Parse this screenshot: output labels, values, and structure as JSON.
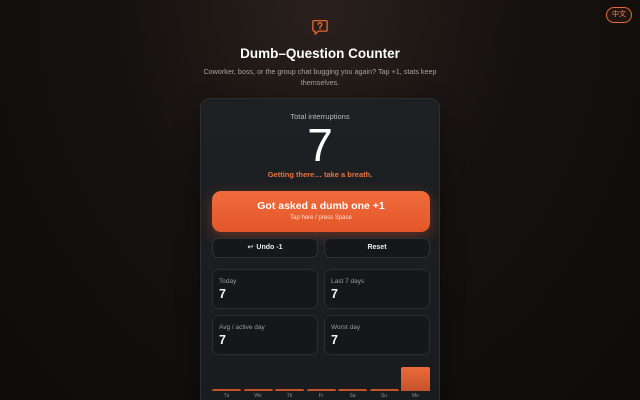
{
  "header": {
    "lang_button": "中文",
    "title": "Dumb–Question Counter",
    "subtitle": "Coworker, boss, or the group chat bugging you again? Tap +1, stats keep themselves."
  },
  "counter": {
    "total_label": "Total interruptions",
    "total_value": "7",
    "status_message": "Getting there… take a breath."
  },
  "actions": {
    "main_label": "Got asked a dumb one +1",
    "main_hint": "Tap here / press Space",
    "undo_label": "Undo -1",
    "reset_label": "Reset"
  },
  "stats": [
    {
      "label": "Today",
      "value": "7"
    },
    {
      "label": "Last 7 days",
      "value": "7"
    },
    {
      "label": "Avg / active day",
      "value": "7"
    },
    {
      "label": "Worst day",
      "value": "7"
    }
  ],
  "colors": {
    "accent": "#e8622f",
    "card_bg": "#1c1f22",
    "page_bg": "#121010"
  },
  "chart_data": {
    "type": "bar",
    "categories": [
      "Tu",
      "We",
      "Th",
      "Fr",
      "Sa",
      "Su",
      "Mo"
    ],
    "values": [
      0,
      0,
      0,
      0,
      0,
      0,
      7
    ],
    "ylim": [
      0,
      7
    ]
  }
}
